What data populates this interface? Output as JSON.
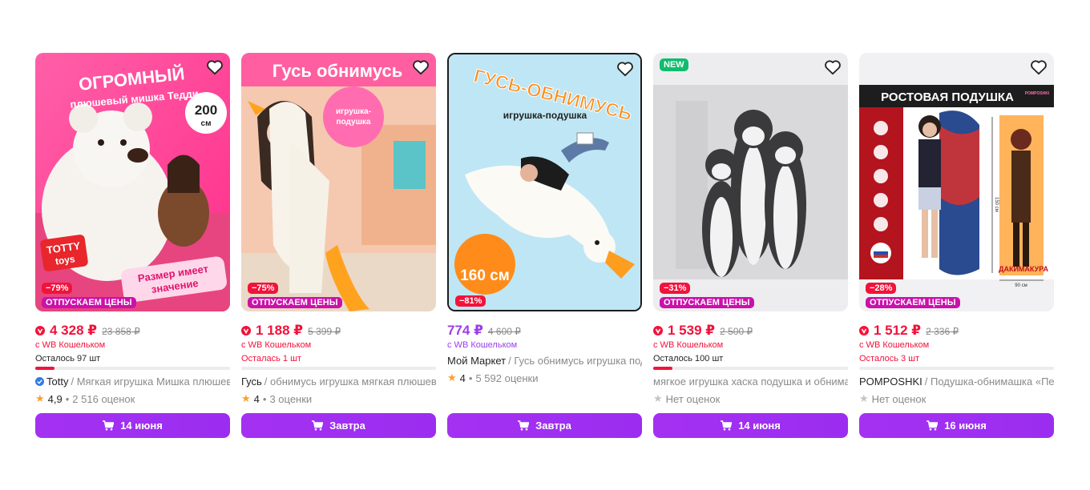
{
  "colors": {
    "price_red": "#f2123a",
    "price_purple": "#9b3ee9",
    "button": "#a431f2",
    "promo_badge": "#cb11ab",
    "new_badge": "#0fbc6d"
  },
  "products": [
    {
      "image_text": [
        "ОГРОМНЫЙ",
        "плюшевый мишка Тедди",
        "200",
        "см",
        "TOTTY",
        "toys",
        "Размер имеет",
        "значение"
      ],
      "discount": "−79%",
      "promo": "ОТПУСКАЕМ ЦЕНЫ",
      "price": "4 328 ₽",
      "old_price": "23 858 ₽",
      "wallet": "с WB Кошельком",
      "stock": "Осталось 97 шт",
      "stock_level": 0.1,
      "brand": "Totty",
      "name": "/ Мягкая игрушка Мишка плюшевый",
      "rating": "4,9",
      "reviews": "2 516 оценок",
      "delivery": "14 июня"
    },
    {
      "image_text": [
        "Гусь обнимусь",
        "игрушка-подушка"
      ],
      "discount": "−75%",
      "promo": "ОТПУСКАЕМ ЦЕНЫ",
      "price": "1 188 ₽",
      "old_price": "5 399 ₽",
      "wallet": "с WB Кошельком",
      "stock": "Осталась 1 шт",
      "stock_level": 0.0,
      "brand": "Гусь",
      "name": "/ обнимусь игрушка мягкая плюшевая",
      "rating": "4",
      "reviews": "3 оценки",
      "delivery": "Завтра"
    },
    {
      "image_text": [
        "ГУСЬ-ОБНИМУСЬ",
        "игрушка-подушка",
        "160 см"
      ],
      "discount": "−81%",
      "price": "774 ₽",
      "old_price": "4 600 ₽",
      "wallet": "с WB Кошельком",
      "brand": "Мой Маркет",
      "name": "/ Гусь обнимусь игрушка подушка",
      "rating": "4",
      "reviews": "5 592 оценки",
      "delivery": "Завтра"
    },
    {
      "new_label": "NEW",
      "discount": "−31%",
      "promo": "ОТПУСКАЕМ ЦЕНЫ",
      "price": "1 539 ₽",
      "old_price": "2 500 ₽",
      "wallet": "с WB Кошельком",
      "stock": "Осталось 100 шт",
      "stock_level": 0.1,
      "brand": "",
      "name": "мягкое игрушка хаска подушка и обнимашка",
      "rating_label": "Нет оценок",
      "delivery": "14 июня"
    },
    {
      "image_text": [
        "РОСТОВАЯ ПОДУШКА",
        "POMPOSHKI",
        "90 см",
        "150 см",
        "ДАКИМАКУРА"
      ],
      "discount": "−28%",
      "promo": "ОТПУСКАЕМ ЦЕНЫ",
      "price": "1 512 ₽",
      "old_price": "2 336 ₽",
      "wallet": "с WB Кошельком",
      "stock": "Осталось 3 шт",
      "stock_level": 0.0,
      "brand": "POMPOSHKI",
      "name": "/ Подушка-обнимашка «Персонаж»",
      "rating_label": "Нет оценок",
      "delivery": "16 июня"
    }
  ]
}
